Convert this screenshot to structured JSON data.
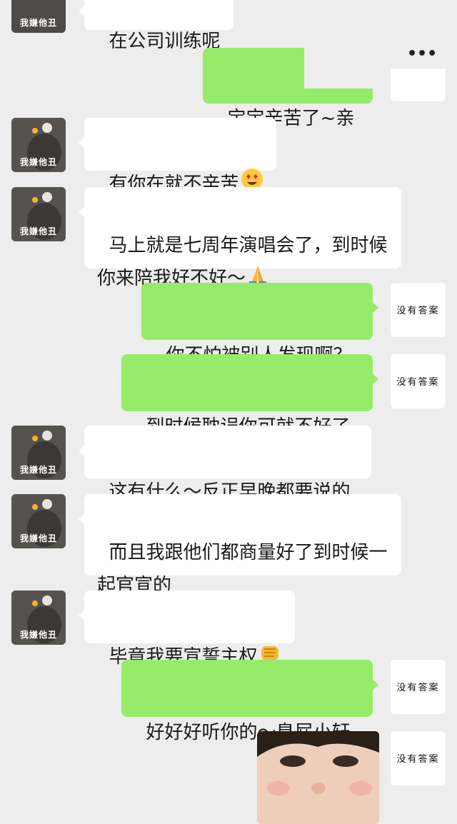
{
  "menu": {
    "more_label": "•••"
  },
  "contact": {
    "avatar_label": "我嫌他丑"
  },
  "me": {
    "avatar_label": "没有答案"
  },
  "messages": [
    {
      "side": "recv",
      "text": "在公司训练呢"
    },
    {
      "side": "sent",
      "text": "宝宝辛苦了~亲亲"
    },
    {
      "side": "recv",
      "text": "有你在就不辛苦",
      "emoji": "heart-eyes-emoji"
    },
    {
      "side": "recv",
      "text": "马上就是七周年演唱会了，到时候你来陪我好不好～",
      "emoji": "praying-hands-emoji"
    },
    {
      "side": "sent",
      "text": "你不怕被别人发现啊？"
    },
    {
      "side": "sent",
      "text": "到时候耽误你可就不好了"
    },
    {
      "side": "recv",
      "text": "这有什么～反正早晚都要说的"
    },
    {
      "side": "recv",
      "text": "而且我跟他们都商量好了到时候一起官宣的"
    },
    {
      "side": "recv",
      "text": "毕竟我要宣誓主权",
      "emoji": "fist-emoji"
    },
    {
      "side": "sent",
      "text": "好好好听你的～臭屁小轩"
    },
    {
      "side": "sent",
      "type": "photo",
      "description_icon": "selfie-photo"
    }
  ]
}
